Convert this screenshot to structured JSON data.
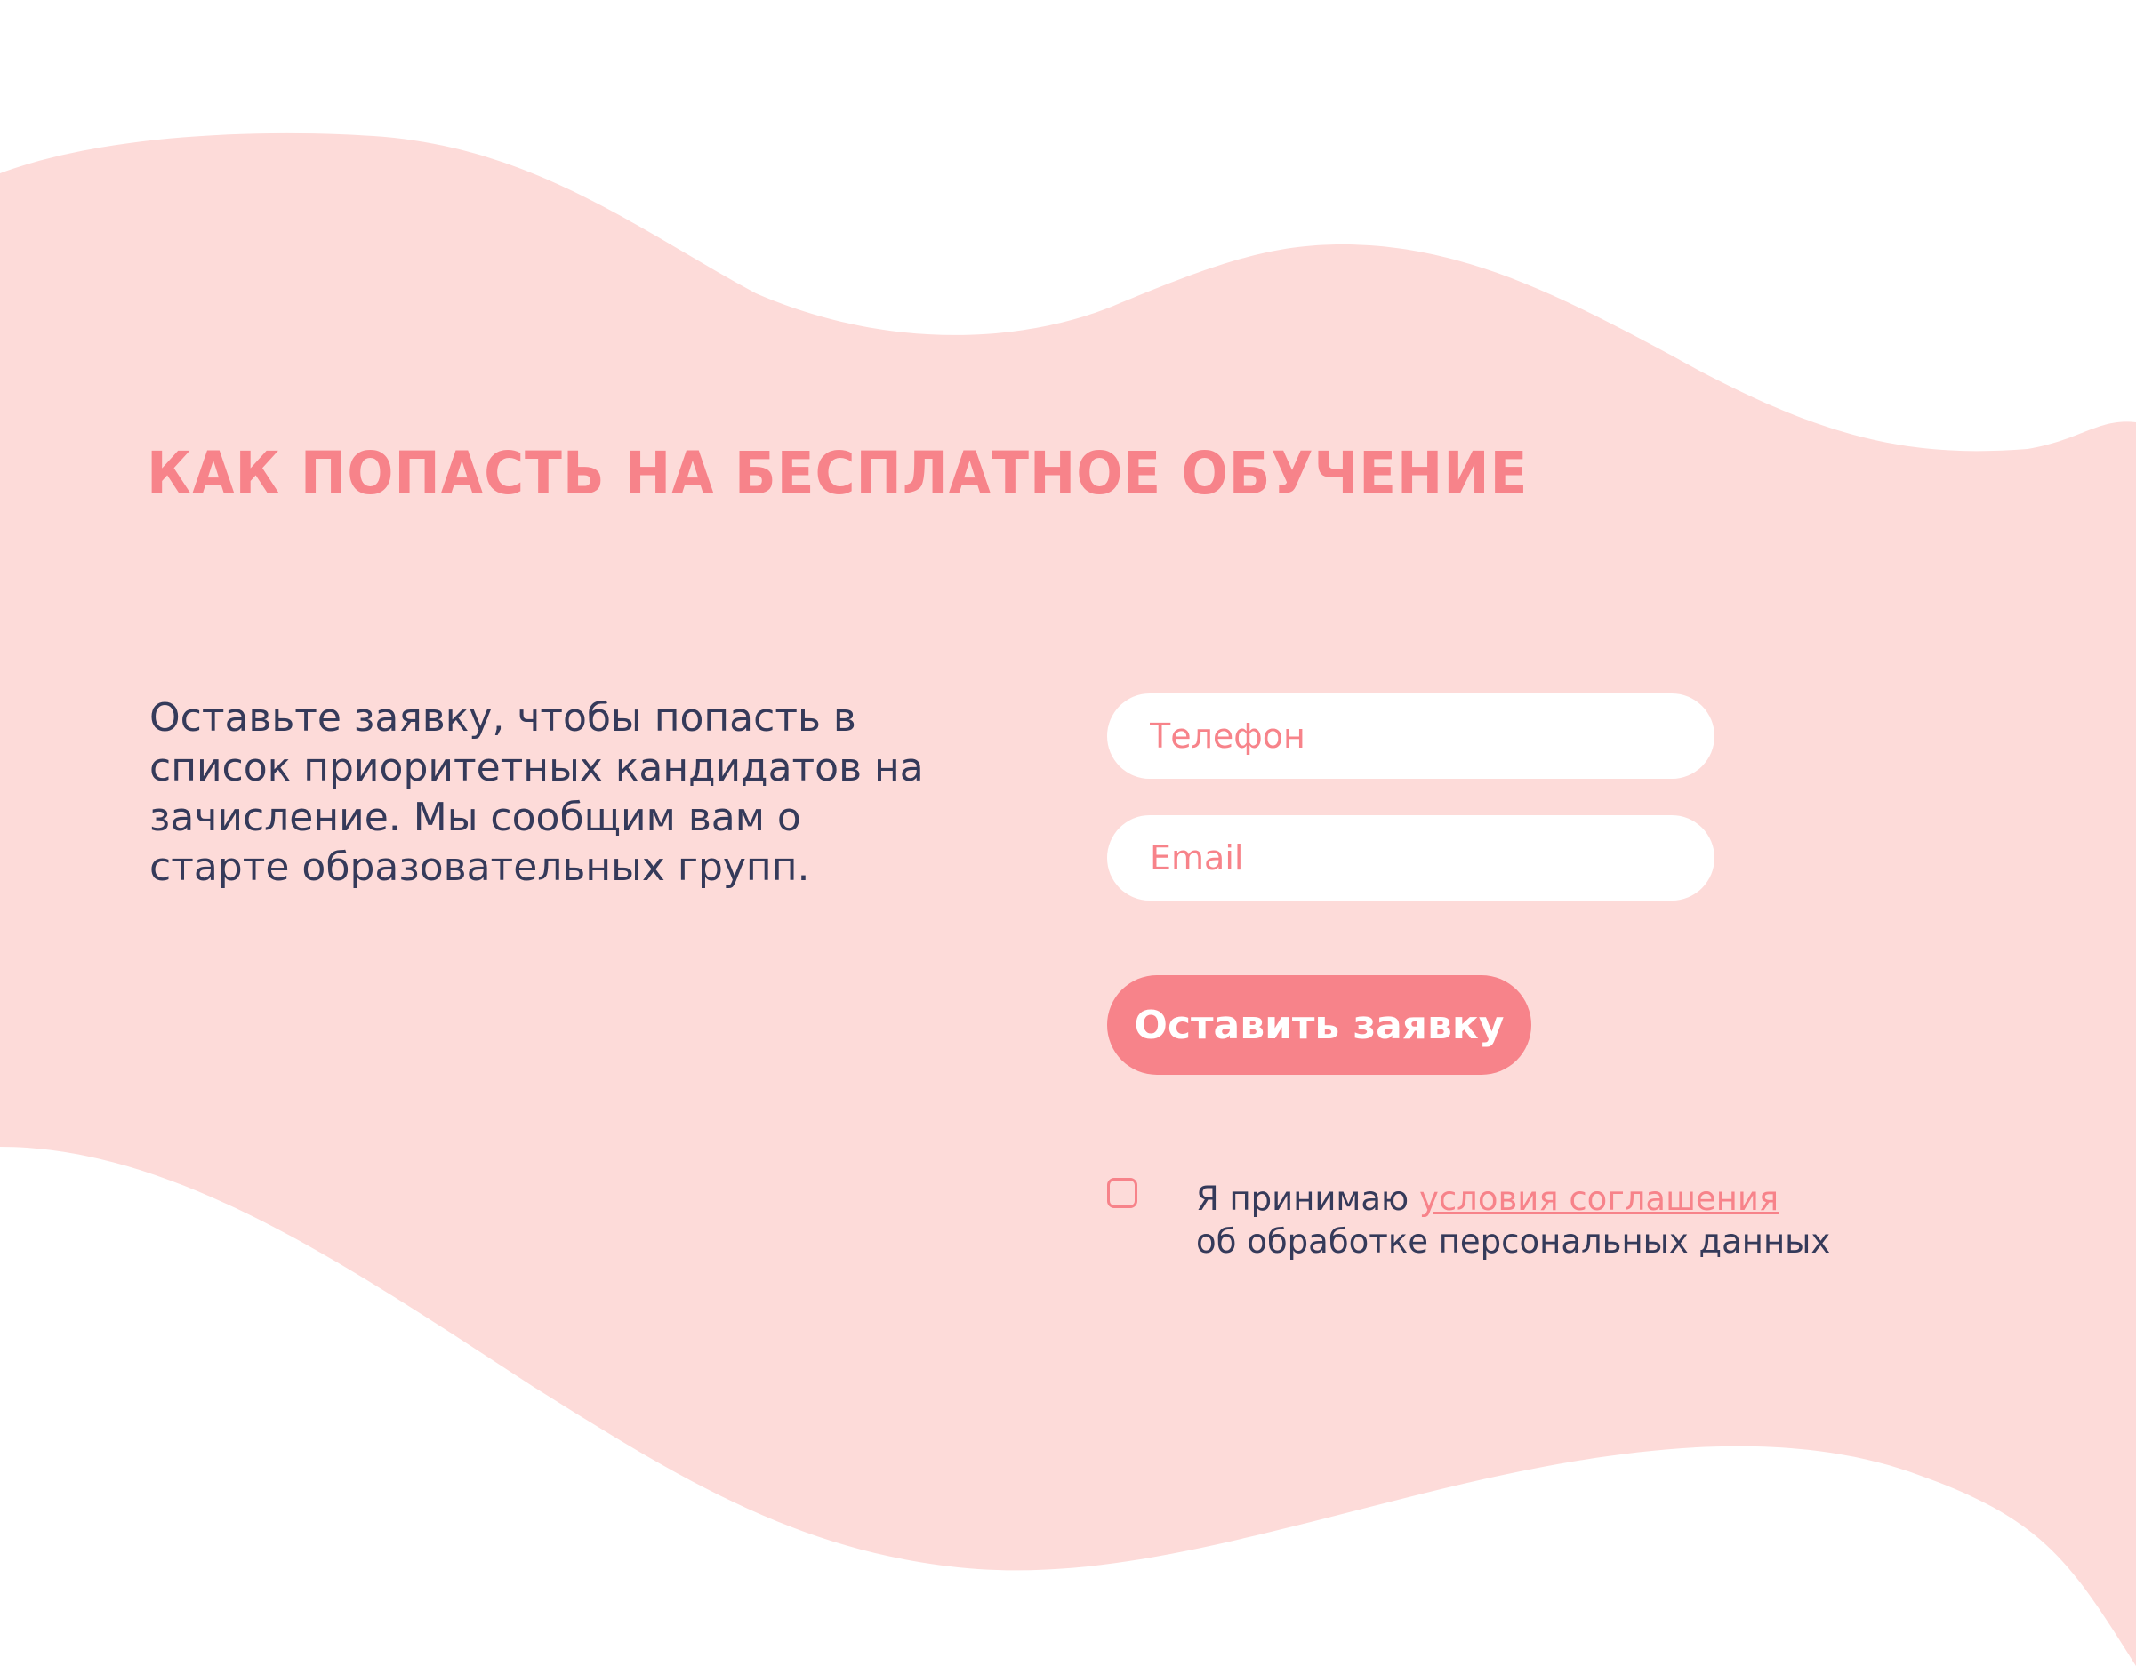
{
  "colors": {
    "background": "#ffffff",
    "wave": "#fddbd9",
    "accent": "#f7838a",
    "text": "#353a5a",
    "field_background": "#ffffff"
  },
  "section": {
    "title": "КАК ПОПАСТЬ НА БЕСПЛАТНОЕ ОБУЧЕНИЕ",
    "description": "Оставьте заявку, чтобы попасть в список приоритетных кандидатов на зачисление. Мы сообщим вам о старте образовательных групп."
  },
  "form": {
    "phone": {
      "placeholder": "Телефон",
      "value": ""
    },
    "email": {
      "placeholder": "Email",
      "value": ""
    },
    "submit_label": "Оставить заявку",
    "consent": {
      "checked": false,
      "text_before": "Я принимаю ",
      "link_text": "условия соглашения",
      "text_after": "об обработке персональных данных"
    }
  }
}
